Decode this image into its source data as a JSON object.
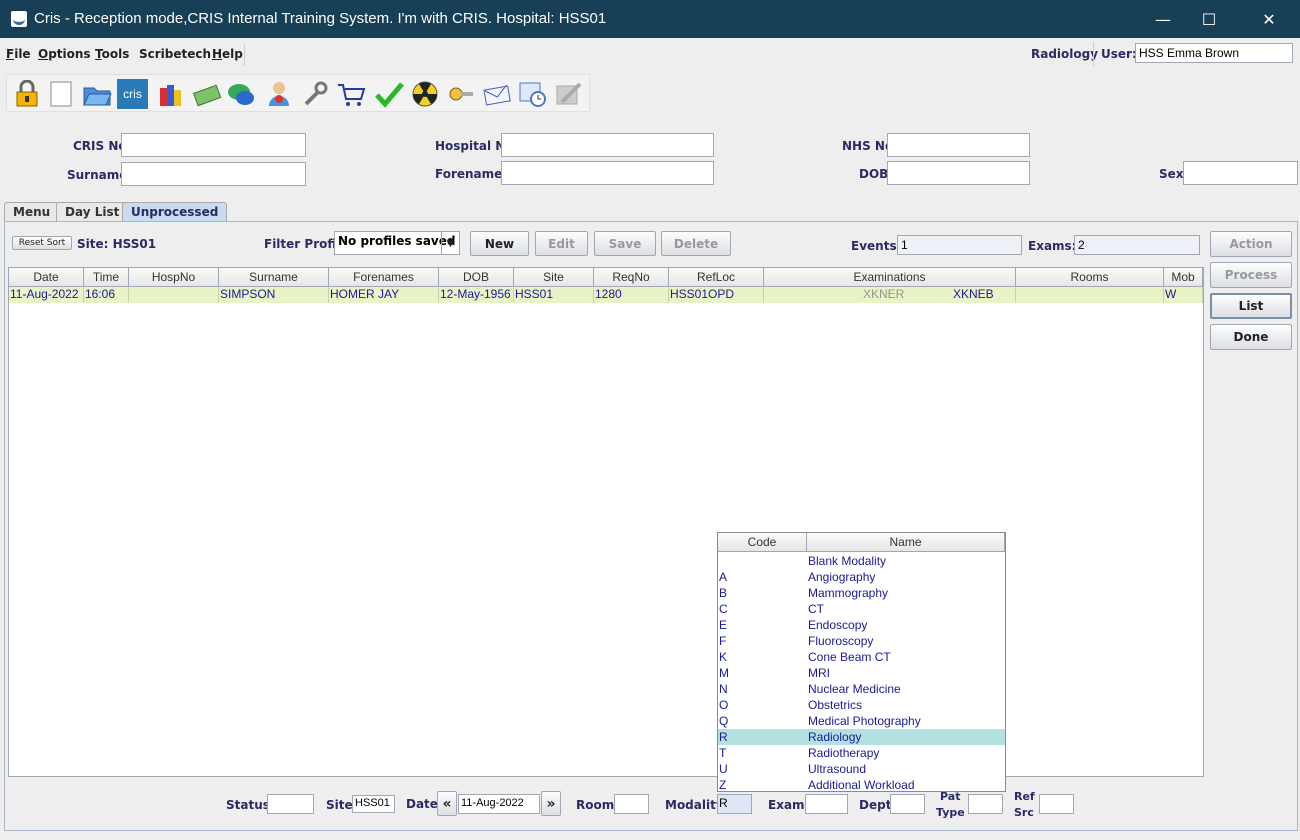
{
  "window": {
    "title": "Cris - Reception mode,CRIS Internal Training System. I'm with CRIS.   Hospital: HSS01",
    "minimize": "—",
    "maximize": "☐",
    "close": "✕"
  },
  "menu": {
    "file": {
      "u": "F",
      "rest": "ile"
    },
    "options": {
      "u": "O",
      "rest": "ptions"
    },
    "tools": {
      "u": "T",
      "rest": "ools"
    },
    "scribetech": {
      "u": "",
      "rest": "Scribetech"
    },
    "help": {
      "u": "H",
      "rest": "elp"
    }
  },
  "header": {
    "department": "Radiology",
    "user_label": "User:",
    "user_value": "HSS Emma Brown"
  },
  "toolbar": {
    "icons": [
      "lock-icon",
      "blank-page-icon",
      "open-folder-icon",
      "cris-icon",
      "books-icon",
      "money-icon",
      "chat-icon",
      "person-info-icon",
      "wrench-icon",
      "cart-icon",
      "checkmark-icon",
      "radiation-icon",
      "key-icon",
      "mail-icon",
      "calendar-clock-icon",
      "disabled-edit-icon"
    ],
    "cris_label": "cris"
  },
  "search": {
    "cris_no_label": "CRIS No",
    "cris_no": "",
    "hospital_no_label": "Hospital No",
    "hospital_no": "",
    "nhs_no_label": "NHS No",
    "nhs_no": "",
    "surname_label": "Surname",
    "surname": "",
    "forenames_label": "Forenames",
    "forenames": "",
    "dob_label": "DOB",
    "dob": "",
    "sex_label": "Sex",
    "sex": ""
  },
  "tabs": [
    "Menu",
    "Day List",
    "Unprocessed"
  ],
  "panel": {
    "reset_sort": "Reset Sort",
    "site_label": "Site: HSS01",
    "filter_profile_label": "Filter Profile",
    "filter_profile_value": "No profiles saved",
    "new": "New",
    "edit": "Edit",
    "save": "Save",
    "delete": "Delete",
    "events_label": "Events:",
    "events_value": "1",
    "exams_label": "Exams:",
    "exams_value": "2"
  },
  "side_buttons": {
    "action": "Action",
    "process": "Process",
    "list": "List",
    "done": "Done"
  },
  "table": {
    "columns": [
      "Date",
      "Time",
      "HospNo",
      "Surname",
      "Forenames",
      "DOB",
      "Site",
      "ReqNo",
      "RefLoc",
      "Examinations",
      "Rooms",
      "Mob"
    ],
    "rows": [
      {
        "date": "11-Aug-2022",
        "time": "16:06",
        "hospno": "",
        "surname": "SIMPSON",
        "forenames": "HOMER JAY",
        "dob": "12-May-1956",
        "site": "HSS01",
        "reqno": "1280",
        "refloc": "HSS01OPD",
        "exam1": "XKNER",
        "exam2": "XKNEB",
        "rooms": "",
        "mob": "W"
      }
    ]
  },
  "modality_popup": {
    "columns": [
      "Code",
      "Name"
    ],
    "rows": [
      {
        "code": "",
        "name": "Blank Modality"
      },
      {
        "code": "A",
        "name": "Angiography"
      },
      {
        "code": "B",
        "name": "Mammography"
      },
      {
        "code": "C",
        "name": "CT"
      },
      {
        "code": "E",
        "name": "Endoscopy"
      },
      {
        "code": "F",
        "name": "Fluoroscopy"
      },
      {
        "code": "K",
        "name": "Cone Beam CT"
      },
      {
        "code": "M",
        "name": "MRI"
      },
      {
        "code": "N",
        "name": "Nuclear Medicine"
      },
      {
        "code": "O",
        "name": "Obstetrics"
      },
      {
        "code": "Q",
        "name": "Medical Photography"
      },
      {
        "code": "R",
        "name": "Radiology"
      },
      {
        "code": "T",
        "name": "Radiotherapy"
      },
      {
        "code": "U",
        "name": "Ultrasound"
      },
      {
        "code": "Z",
        "name": "Additional Workload"
      }
    ],
    "selected": "R"
  },
  "filters": {
    "status_label": "Status",
    "status": "",
    "site_label": "Site",
    "site": "HSS01",
    "date_label": "Date",
    "date": "11-Aug-2022",
    "room_label": "Room",
    "room": "",
    "modality_label": "Modality",
    "modality": "R",
    "exam_label": "Exam",
    "exam": "",
    "dept_label": "Dept",
    "dept": "",
    "pat_type_label_1": "Pat",
    "pat_type_label_2": "Type",
    "pat_type": "",
    "ref_src_label_1": "Ref",
    "ref_src_label_2": "Src",
    "ref_src": ""
  }
}
